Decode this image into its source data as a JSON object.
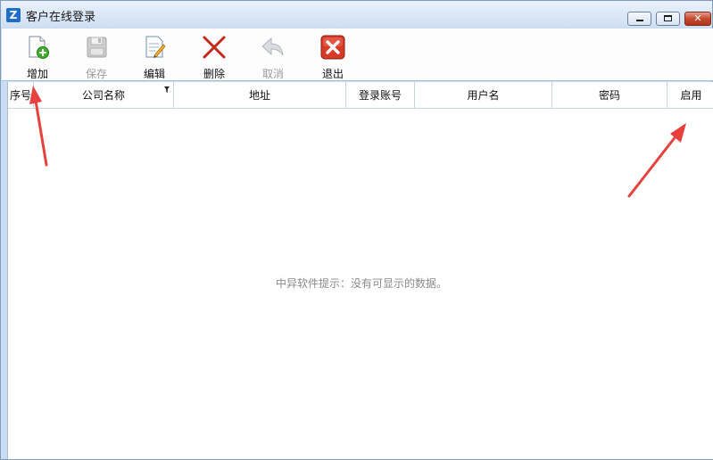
{
  "window": {
    "title": "客户在线登录",
    "app_icon_letter": "Z",
    "close_glyph": "✕"
  },
  "toolbar": {
    "items": [
      {
        "label": "增加",
        "icon": "new-document-add-icon",
        "enabled": true
      },
      {
        "label": "保存",
        "icon": "floppy-disk-icon",
        "enabled": false
      },
      {
        "label": "编辑",
        "icon": "edit-document-icon",
        "enabled": true
      },
      {
        "label": "删除",
        "icon": "delete-x-icon",
        "enabled": true
      },
      {
        "label": "取消",
        "icon": "undo-arrow-icon",
        "enabled": false
      },
      {
        "label": "退出",
        "icon": "exit-red-x-icon",
        "enabled": true
      }
    ]
  },
  "grid": {
    "columns": [
      "序号",
      "公司名称",
      "地址",
      "登录账号",
      "用户名",
      "密码",
      "启用"
    ],
    "rows": [],
    "empty_message": "中异软件提示：没有可显示的数据。"
  },
  "colors": {
    "frame": "#c9dcf2",
    "accent": "#1f6fc9",
    "annotation_arrow": "#e8403c",
    "disabled_text": "#9b9b9b"
  }
}
